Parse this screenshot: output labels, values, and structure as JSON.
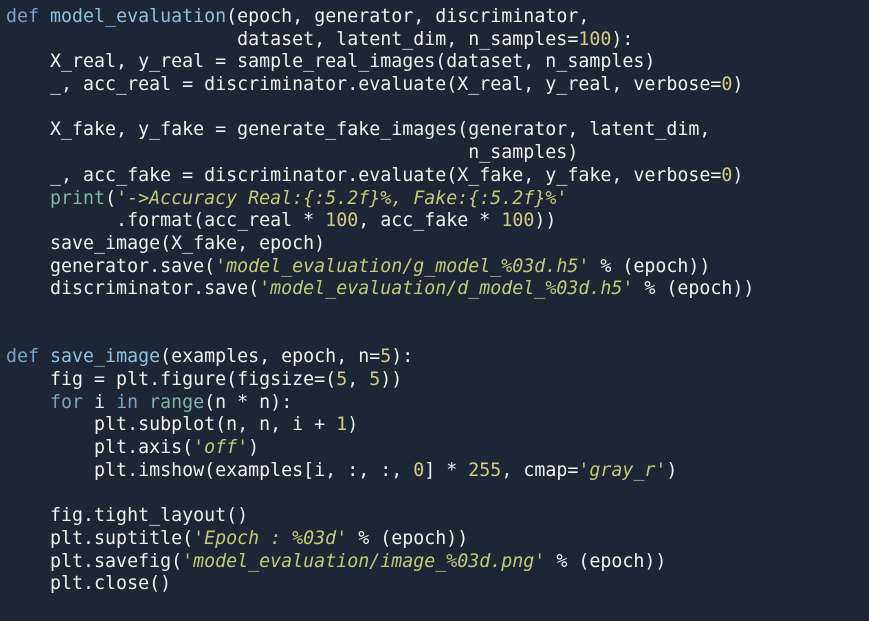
{
  "editor": {
    "colors": {
      "background": "#1d2634",
      "text": "#f0f0f0",
      "keyword": "#79a3c4",
      "function_name": "#8cc0e6",
      "number": "#d9c98a",
      "string": "#c4c87c",
      "builtin": "#7fb6a8"
    },
    "lines": [
      [
        [
          "kw",
          "def "
        ],
        [
          "fn",
          "model_evaluation"
        ],
        [
          "plain",
          "(epoch, generator, discriminator,"
        ]
      ],
      [
        [
          "plain",
          "                     dataset, latent_dim, n_samples="
        ],
        [
          "num",
          "100"
        ],
        [
          "plain",
          "):"
        ]
      ],
      [
        [
          "plain",
          "    X_real, y_real = sample_real_images(dataset, n_samples)"
        ]
      ],
      [
        [
          "plain",
          "    _, acc_real = discriminator.evaluate(X_real, y_real, verbose="
        ],
        [
          "num",
          "0"
        ],
        [
          "plain",
          ")"
        ]
      ],
      [
        [
          "plain",
          ""
        ]
      ],
      [
        [
          "plain",
          "    X_fake, y_fake = generate_fake_images(generator, latent_dim,"
        ]
      ],
      [
        [
          "plain",
          "                                          n_samples)"
        ]
      ],
      [
        [
          "plain",
          "    _, acc_fake = discriminator.evaluate(X_fake, y_fake, verbose="
        ],
        [
          "num",
          "0"
        ],
        [
          "plain",
          ")"
        ]
      ],
      [
        [
          "plain",
          "    "
        ],
        [
          "bi",
          "print"
        ],
        [
          "plain",
          "("
        ],
        [
          "str",
          "'->Accuracy Real:{:5.2f}%, Fake:{:5.2f}%'"
        ]
      ],
      [
        [
          "plain",
          "          .format(acc_real * "
        ],
        [
          "num",
          "100"
        ],
        [
          "plain",
          ", acc_fake * "
        ],
        [
          "num",
          "100"
        ],
        [
          "plain",
          "))"
        ]
      ],
      [
        [
          "plain",
          "    save_image(X_fake, epoch)"
        ]
      ],
      [
        [
          "plain",
          "    generator.save("
        ],
        [
          "str",
          "'model_evaluation/g_model_%03d.h5'"
        ],
        [
          "plain",
          " % (epoch))"
        ]
      ],
      [
        [
          "plain",
          "    discriminator.save("
        ],
        [
          "str",
          "'model_evaluation/d_model_%03d.h5'"
        ],
        [
          "plain",
          " % (epoch))"
        ]
      ],
      [
        [
          "plain",
          ""
        ]
      ],
      [
        [
          "plain",
          ""
        ]
      ],
      [
        [
          "kw",
          "def "
        ],
        [
          "fn",
          "save_image"
        ],
        [
          "plain",
          "(examples, epoch, n="
        ],
        [
          "num",
          "5"
        ],
        [
          "plain",
          "):"
        ]
      ],
      [
        [
          "plain",
          "    fig = plt.figure(figsize=("
        ],
        [
          "num",
          "5"
        ],
        [
          "plain",
          ", "
        ],
        [
          "num",
          "5"
        ],
        [
          "plain",
          "))"
        ]
      ],
      [
        [
          "plain",
          "    "
        ],
        [
          "kw",
          "for"
        ],
        [
          "plain",
          " i "
        ],
        [
          "kw",
          "in"
        ],
        [
          "plain",
          " "
        ],
        [
          "bi",
          "range"
        ],
        [
          "plain",
          "(n * n):"
        ]
      ],
      [
        [
          "plain",
          "        plt.subplot(n, n, i + "
        ],
        [
          "num",
          "1"
        ],
        [
          "plain",
          ")"
        ]
      ],
      [
        [
          "plain",
          "        plt.axis("
        ],
        [
          "str",
          "'off'"
        ],
        [
          "plain",
          ")"
        ]
      ],
      [
        [
          "plain",
          "        plt.imshow(examples[i, :, :, "
        ],
        [
          "num",
          "0"
        ],
        [
          "plain",
          "] * "
        ],
        [
          "num",
          "255"
        ],
        [
          "plain",
          ", cmap="
        ],
        [
          "str",
          "'gray_r'"
        ],
        [
          "plain",
          ")"
        ]
      ],
      [
        [
          "plain",
          ""
        ]
      ],
      [
        [
          "plain",
          "    fig.tight_layout()"
        ]
      ],
      [
        [
          "plain",
          "    plt.suptitle("
        ],
        [
          "str",
          "'Epoch : %03d'"
        ],
        [
          "plain",
          " % (epoch))"
        ]
      ],
      [
        [
          "plain",
          "    plt.savefig("
        ],
        [
          "str",
          "'model_evaluation/image_%03d.png'"
        ],
        [
          "plain",
          " % (epoch))"
        ]
      ],
      [
        [
          "plain",
          "    plt.close()"
        ]
      ]
    ]
  }
}
